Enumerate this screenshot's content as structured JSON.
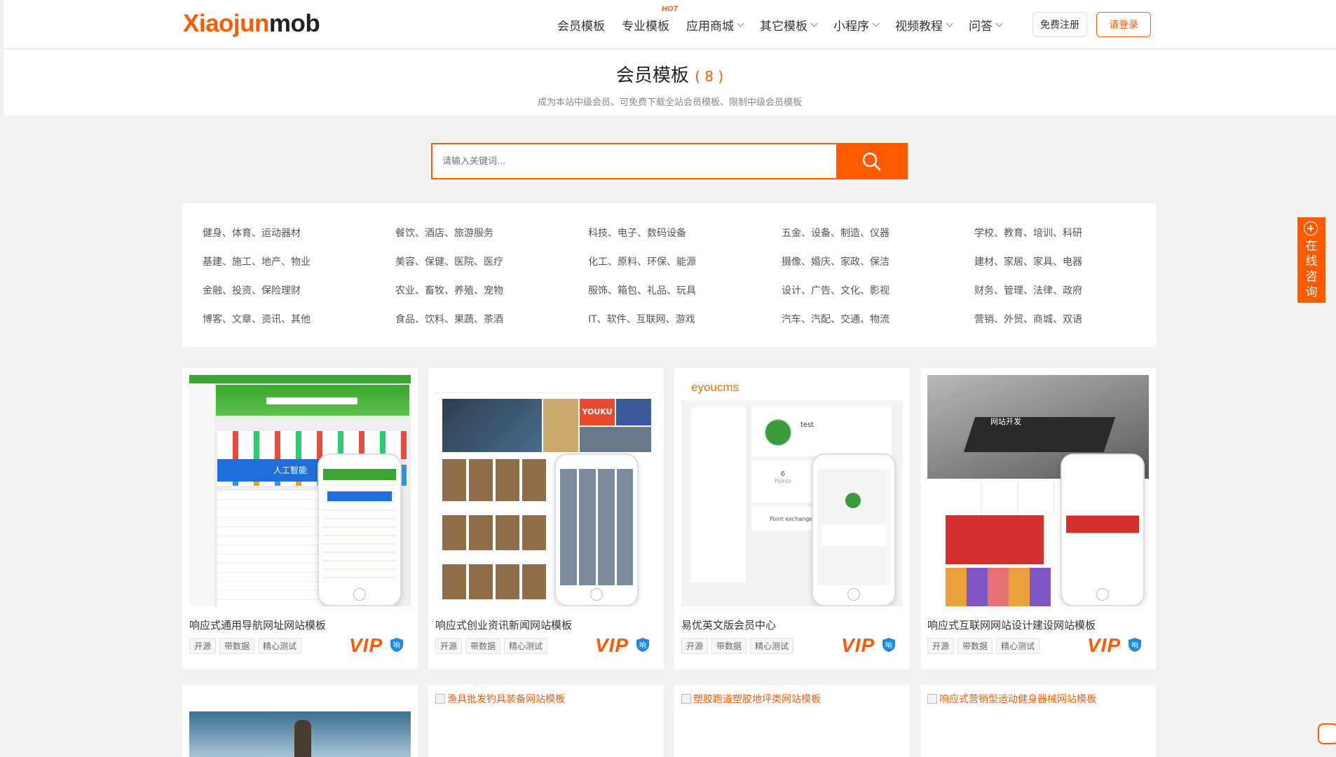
{
  "header": {
    "logo_part1": "Xiaojun",
    "logo_part2": "mob",
    "nav": [
      {
        "label": "会员模板",
        "dropdown": false
      },
      {
        "label": "专业模板",
        "dropdown": false,
        "badge": "HOT"
      },
      {
        "label": "应用商城",
        "dropdown": true
      },
      {
        "label": "其它模板",
        "dropdown": true
      },
      {
        "label": "小程序",
        "dropdown": true
      },
      {
        "label": "视频教程",
        "dropdown": true
      },
      {
        "label": "问答",
        "dropdown": true
      }
    ],
    "register_label": "免费注册",
    "login_label": "请登录"
  },
  "banner": {
    "title": "会员模板",
    "count": "( 8 )",
    "subtitle": "成为本站中级会员、可免费下载全站会员模板、限制中级会员模板"
  },
  "search": {
    "placeholder": "请输入关键词..."
  },
  "categories": [
    [
      "健身、体育、运动器材",
      "餐饮、酒店、旅游服务",
      "科技、电子、数码设备",
      "五金、设备、制造、仪器",
      "学校、教育、培训、科研"
    ],
    [
      "基建、施工、地产、物业",
      "美容、保健、医院、医疗",
      "化工、原料、环保、能源",
      "摄像、婚庆、家政、保洁",
      "建材、家居、家具、电器"
    ],
    [
      "金融、投资、保险理财",
      "农业、畜牧、养殖、宠物",
      "服饰、箱包、礼品、玩具",
      "设计、广告、文化、影视",
      "财务、管理、法律、政府"
    ],
    [
      "博客、文章、资讯、其他",
      "食品、饮料、果蔬、茶酒",
      "IT、软件、互联网、游戏",
      "汽车、汽配、交通、物流",
      "营销、外贸、商城、双语"
    ]
  ],
  "cards": [
    {
      "title": "响应式通用导航网址网站模板",
      "tags": [
        "开源",
        "带数据",
        "精心测试"
      ],
      "vip": "VIP",
      "resp_badge": "响",
      "thumb_banner": "人工智能"
    },
    {
      "title": "响应式创业资讯新闻网站模板",
      "tags": [
        "开源",
        "带数据",
        "精心测试"
      ],
      "vip": "VIP",
      "resp_badge": "响",
      "thumb_banner": "YOUKU"
    },
    {
      "title": "易优英文版会员中心",
      "tags": [
        "开源",
        "带数据",
        "精心测试"
      ],
      "vip": "VIP",
      "resp_badge": "响",
      "thumb_logo": "eyoucms",
      "thumb_user": "test",
      "thumb_points": "6",
      "thumb_points_label": "Points",
      "thumb_exchange": "Point exchange"
    },
    {
      "title": "响应式互联网网站设计建设网站模板",
      "tags": [
        "开源",
        "带数据",
        "精心测试"
      ],
      "vip": "VIP",
      "resp_badge": "响",
      "thumb_banner": "网站开发"
    }
  ],
  "broken_images": [
    "渔具批发钓具装备网站模板",
    "塑胶跑道塑胶地坪类网站模板",
    "响应式营销型运动健身器械网站模板"
  ],
  "consult": {
    "label": "在线咨询"
  },
  "colors": {
    "accent": "#ff5a00",
    "green": "#3aa630",
    "blue": "#1e88e5"
  }
}
